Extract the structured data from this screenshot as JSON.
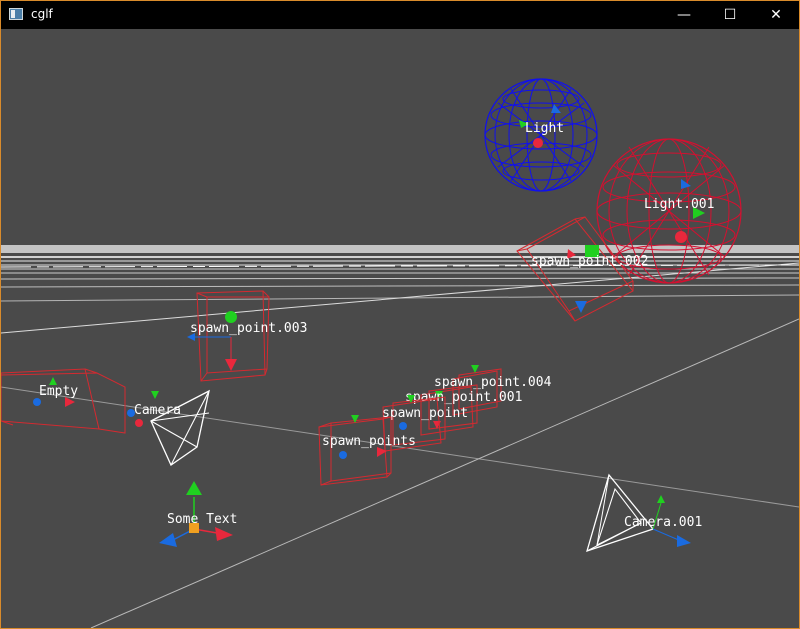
{
  "window": {
    "title": "cglf",
    "minimize_glyph": "—",
    "maximize_glyph": "☐",
    "close_glyph": "✕"
  },
  "scene": {
    "labels": {
      "light": "Light",
      "light_001": "Light.001",
      "spawn_point_002": "spawn_point.002",
      "spawn_point_003": "spawn_point.003",
      "spawn_point_004": "spawn_point.004",
      "spawn_point_001": "spawn_point.001",
      "spawn_point": "spawn_point",
      "empty": "Empty",
      "camera": "Camera",
      "camera_001": "Camera.001",
      "spawn_points": "spawn_points",
      "some_text": "Some Text"
    }
  },
  "colors": {
    "background": "#4a4a4a",
    "titlebar": "#000000",
    "window_border": "#d98b2b",
    "horizon_band": "#c4c4c4",
    "axis_red": "#e8283c",
    "axis_green": "#20d020",
    "axis_blue": "#1a6be0",
    "wire_blue": "#1010ee",
    "wire_red": "#d41030",
    "bbox_red": "#d42a30",
    "origin_orange": "#f0a020"
  }
}
